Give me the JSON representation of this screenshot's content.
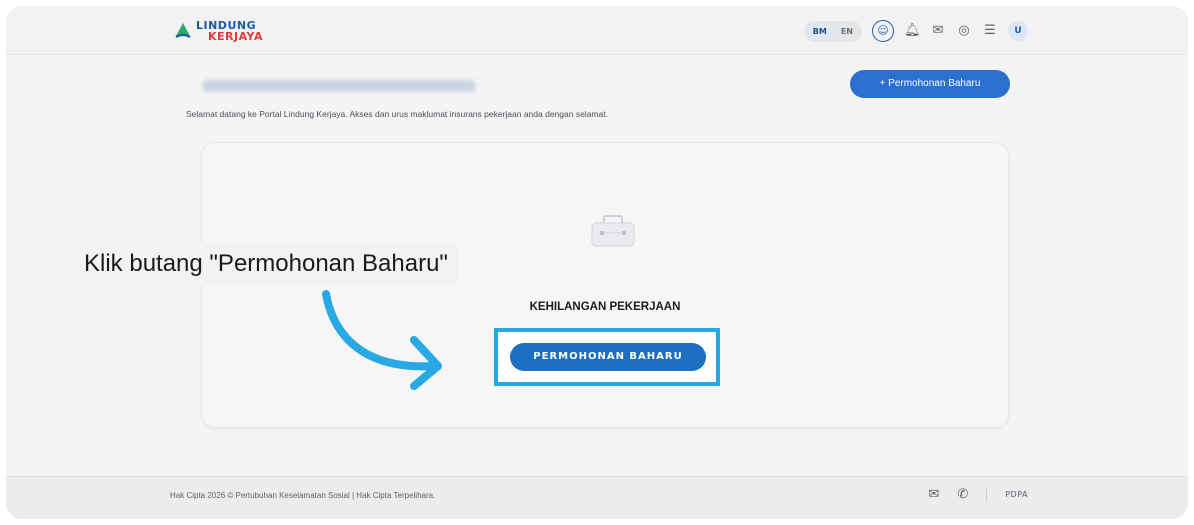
{
  "header": {
    "logo_top": "LINDUNG",
    "logo_bottom": "KERJAYA",
    "lang_bm": "BM",
    "lang_en": "EN",
    "avatar_initial": "U",
    "icons": [
      "accessibility-icon",
      "bell-icon",
      "mail-icon",
      "palette-icon",
      "menu-icon"
    ]
  },
  "main": {
    "welcome_text": "Selamat datang ke Portal Lindung Kerjaya. Akses dan urus maklumat insurans pekerjaan anda dengan selamat.",
    "new_application_top": "+ Permohonan Baharu",
    "card_title": "KEHILANGAN PEKERJAAN",
    "cta_label": "PERMOHONAN BAHARU"
  },
  "annotation": {
    "callout_text": "Klik butang \"Permohonan Baharu\"",
    "highlight_color": "#29a9e3",
    "arrow_color": "#29a9e3"
  },
  "footer": {
    "copyright": "Hak Cipta 2026 © Pertubuhan Keselamatan Sosial | Hak Cipta Terpelihara.",
    "pdpa": "PDPA",
    "icons": [
      "mail-icon",
      "phone-icon"
    ]
  },
  "colors": {
    "primary": "#1d6fc2",
    "logo_blue": "#1a5aa6",
    "logo_red": "#e23a3a"
  }
}
